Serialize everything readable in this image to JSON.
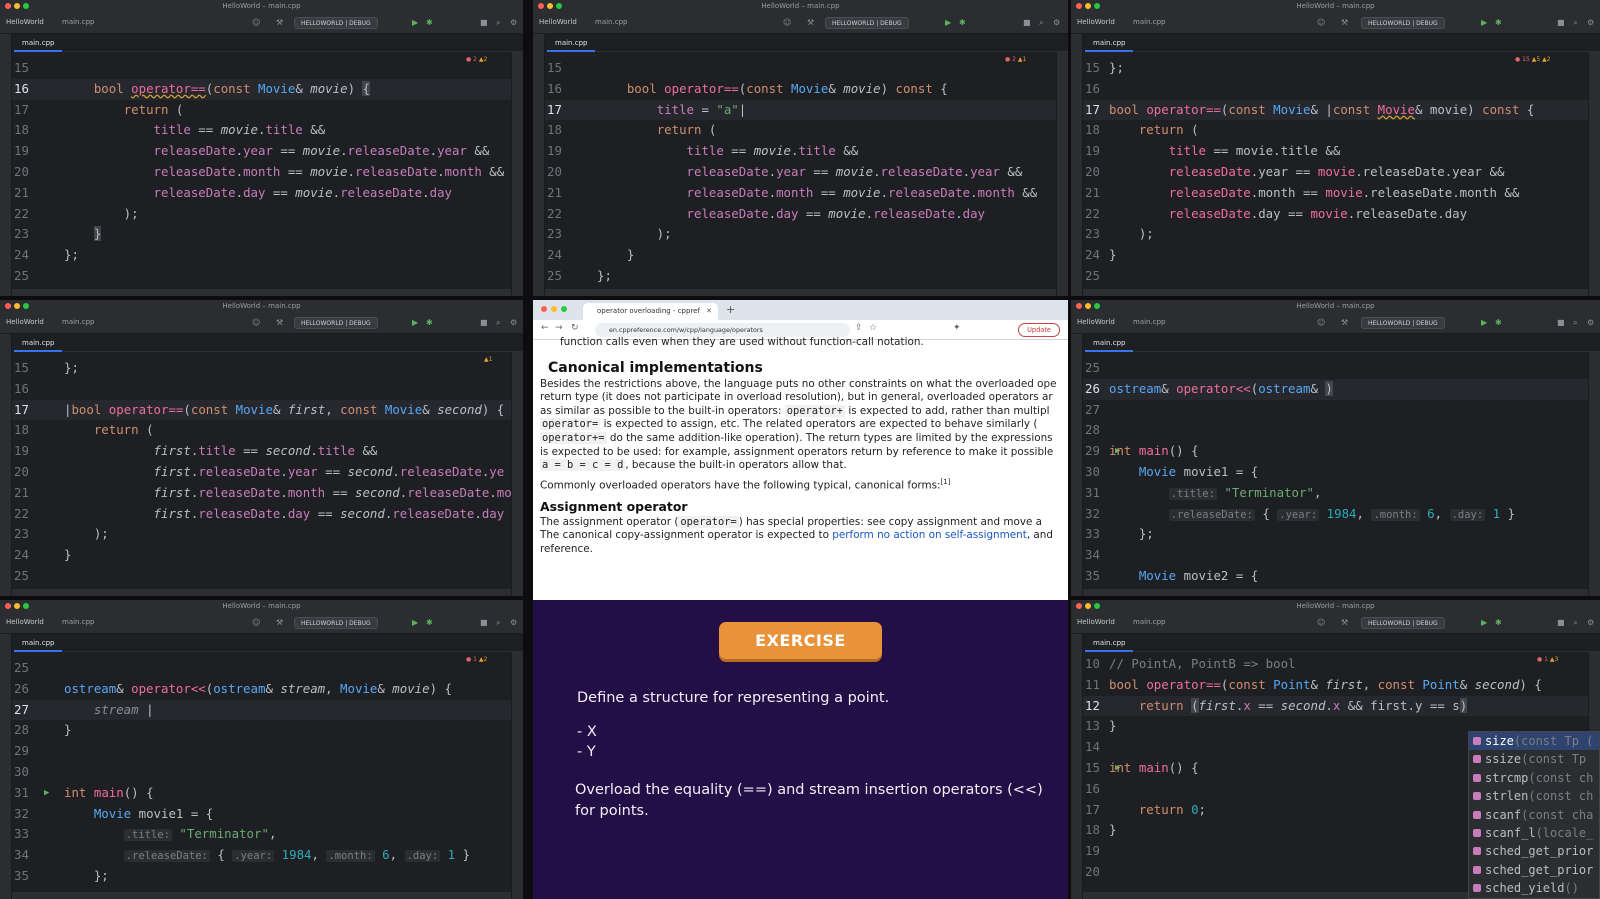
{
  "window_title": "HelloWorld – main.cpp",
  "project": "HelloWorld",
  "file": "main.cpp",
  "run_config": "HELLOWORLD | DEBUG",
  "panes": {
    "p1": {
      "warn_err": "2",
      "warn_w": "2"
    },
    "p2": {
      "warn_err": "2",
      "warn_w": "1"
    },
    "p3": {
      "warn_err": "15",
      "warn_w": "5 ▲2"
    },
    "p4": {
      "warn_w": "1"
    },
    "p5": {
      "warn_err": "1",
      "warn_w": "2"
    },
    "p7": {
      "warn_err": "1",
      "warn_w": "3"
    }
  },
  "browser": {
    "tab_title": "operator overloading - cppref",
    "url": "en.cppreference.com/w/cpp/language/operators",
    "update_label": "Update",
    "line0": "function calls even when they are used without function-call notation.",
    "h_canonical": "Canonical implementations",
    "l1": "Besides the restrictions above, the language puts no other constraints on what the overloaded ope",
    "l2": "return type (it does not participate in overload resolution), but in general, overloaded operators ar",
    "l3a": "as similar as possible to the built-in operators: ",
    "l3code": "operator+",
    "l3b": " is expected to add, rather than multipl",
    "l4code": "operator=",
    "l4b": " is expected to assign, etc. The related operators are expected to behave similarly (",
    "l5code": "operator+=",
    "l5b": " do the same addition-like operation). The return types are limited by the expressions",
    "l6": "is expected to be used: for example, assignment operators return by reference to make it possible",
    "l7code": "a = b = c = d",
    "l7b": ", because the built-in operators allow that.",
    "l8": "Commonly overloaded operators have the following typical, canonical forms:",
    "l8sup": "[1]",
    "h_assign": "Assignment operator",
    "l9a": "The assignment operator (",
    "l9code": "operator=",
    "l9b": ") has special properties: see copy assignment and move a",
    "l10a": "The canonical copy-assignment operator is expected to ",
    "l10link": "perform no action on self-assignment",
    "l10b": ", and",
    "l11": "reference."
  },
  "exercise": {
    "button": "EXERCISE",
    "line1": "Define a structure for representing a point.",
    "x": "- X",
    "y": "- Y",
    "line2": "Overload the equality (==) and stream insertion operators (<<)",
    "line3": "for points."
  },
  "autocomplete": [
    {
      "name": "size",
      "sig": "(const Tp ("
    },
    {
      "name": "ssize",
      "sig": "(const Tp"
    },
    {
      "name": "strcmp",
      "sig": "(const ch"
    },
    {
      "name": "strlen",
      "sig": "(const ch"
    },
    {
      "name": "scanf",
      "sig": "(const cha"
    },
    {
      "name": "scanf_l",
      "sig": "(locale_"
    },
    {
      "name": "sched_get_prior",
      "sig": ""
    },
    {
      "name": "sched_get_prior",
      "sig": ""
    },
    {
      "name": "sched_yield",
      "sig": "()"
    }
  ]
}
